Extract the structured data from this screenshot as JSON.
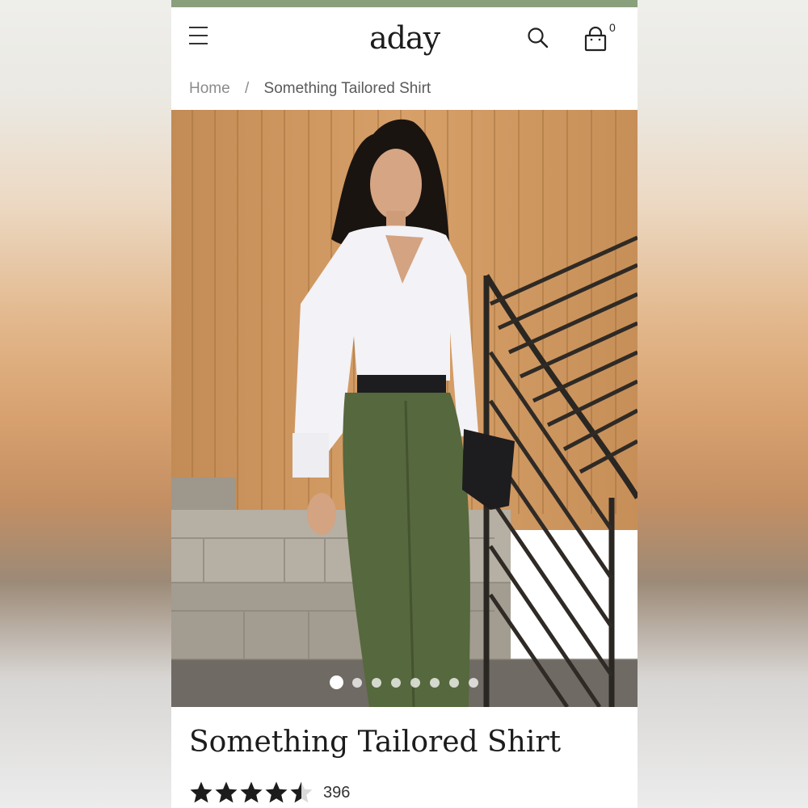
{
  "header": {
    "logo": "aday",
    "cart_count": "0"
  },
  "breadcrumb": {
    "home": "Home",
    "separator": "/",
    "current": "Something Tailored Shirt"
  },
  "gallery": {
    "image_count": 8,
    "active_index": 0
  },
  "product": {
    "title": "Something Tailored Shirt",
    "rating_value": 4.5,
    "rating_max": 5,
    "review_count": "396"
  },
  "icons": {
    "menu": "menu-icon",
    "search": "search-icon",
    "cart": "shopping-bag-icon",
    "star": "star-icon"
  },
  "colors": {
    "accent_bar": "#8aa07d",
    "text": "#1c1c1c",
    "muted": "#8b8b8b"
  }
}
